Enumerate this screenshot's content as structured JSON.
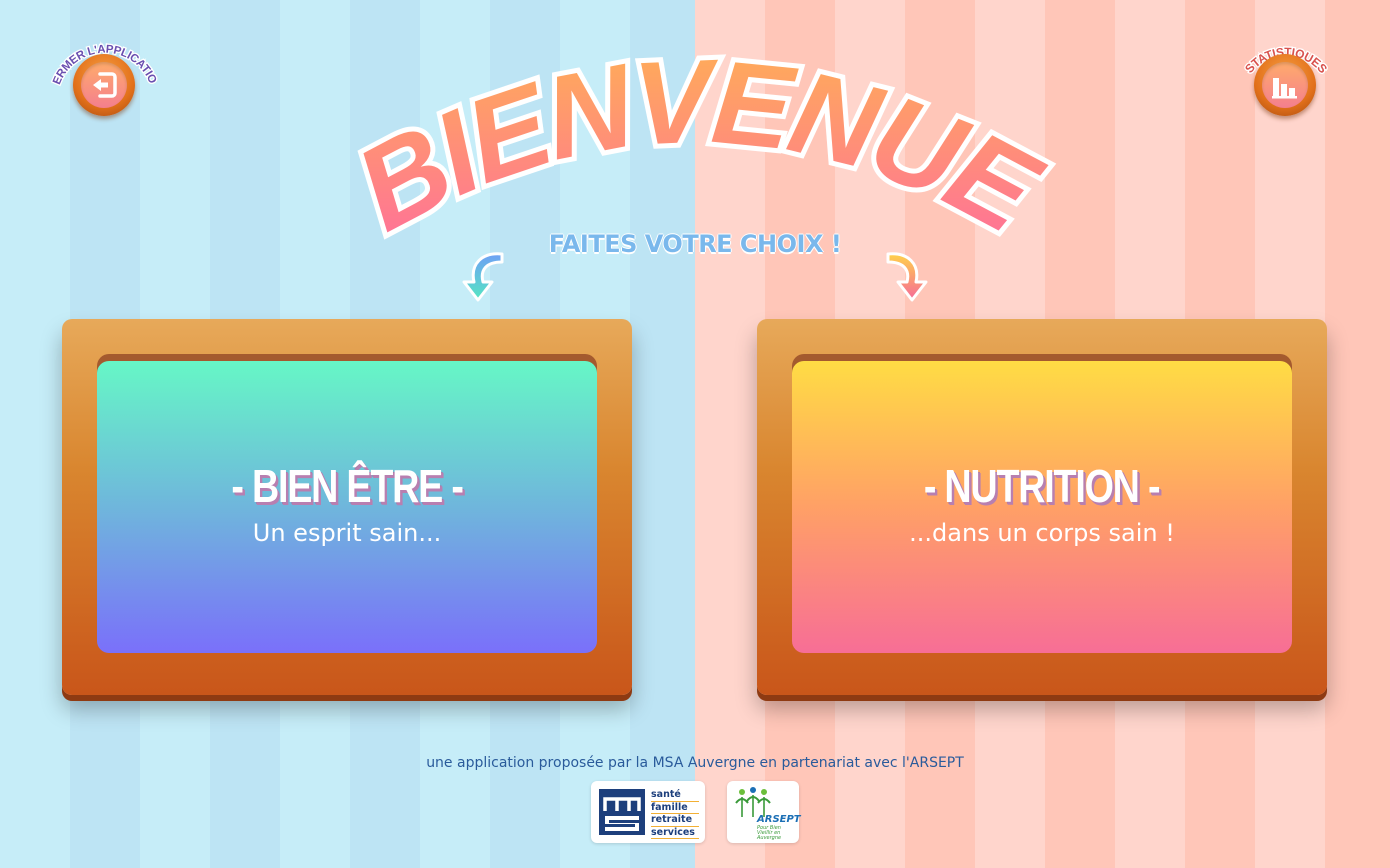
{
  "app": {
    "title": "BIENVENUE",
    "subtitle": "FAITES VOTRE CHOIX !"
  },
  "corners": {
    "close": {
      "label": "FERMER L'APPLICATION",
      "icon": "exit-door-icon"
    },
    "stats": {
      "label": "STATISTIQUES",
      "icon": "bar-chart-icon"
    }
  },
  "choices": {
    "wellbeing": {
      "title": "- BIEN ÊTRE -",
      "subtitle": "Un esprit sain..."
    },
    "nutrition": {
      "title": "- NUTRITION -",
      "subtitle": "...dans un corps sain !"
    }
  },
  "footer": {
    "text": "une application proposée par la MSA Auvergne en partenariat avec l'ARSEPT",
    "msa_logo": {
      "mark": "msa",
      "words": [
        "santé",
        "famille",
        "retraite",
        "services"
      ]
    },
    "arsept_logo": {
      "name": "ARSEPT",
      "tagline": "Pour Bien Vieillir en Auvergne"
    }
  },
  "colors": {
    "left_bg": "#c3ecf8",
    "right_bg": "#ffc6b8",
    "frame": "#d9862f",
    "wellbeing_gradient": [
      "#66f7c6",
      "#7a70fa"
    ],
    "nutrition_gradient": [
      "#ffdc44",
      "#f76e96"
    ]
  }
}
